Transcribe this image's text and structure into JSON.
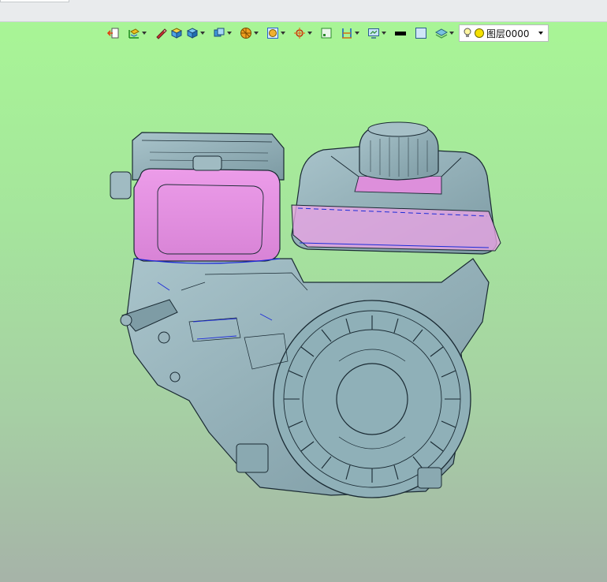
{
  "window": {
    "active_document_tab": ""
  },
  "toolbar": {
    "buttons": [
      {
        "name": "exit-sketch-icon",
        "dropdown": false
      },
      {
        "name": "view-orient-icon",
        "dropdown": true
      },
      {
        "name": "pen-tool-icon",
        "dropdown": false
      },
      {
        "name": "iso-view-icon",
        "dropdown": false
      },
      {
        "name": "shaded-cube-icon",
        "dropdown": true
      },
      {
        "name": "display-style-icon",
        "dropdown": true
      },
      {
        "name": "render-mode-icon",
        "dropdown": true
      },
      {
        "name": "section-view-icon",
        "dropdown": true
      },
      {
        "name": "snap-target-icon",
        "dropdown": true
      },
      {
        "name": "plane-icon",
        "dropdown": false
      },
      {
        "name": "dimension-icon",
        "dropdown": true
      },
      {
        "name": "screen-capture-icon",
        "dropdown": true
      },
      {
        "name": "line-color-icon",
        "dropdown": false
      },
      {
        "name": "fill-color-icon",
        "dropdown": false
      },
      {
        "name": "layers-icon",
        "dropdown": true
      }
    ],
    "layer": {
      "name": "图层0000",
      "visible": true,
      "color": "#f5e000"
    }
  },
  "viewport": {
    "background_top": "#a8f596",
    "background_bottom": "#a6b3a8",
    "model": {
      "name": "engine-model",
      "body_color": "#8fb0b8",
      "highlight_color": "#e08fe0",
      "edge_color": "#1a2a33",
      "selected_edge_color": "#1d2bd9"
    }
  }
}
